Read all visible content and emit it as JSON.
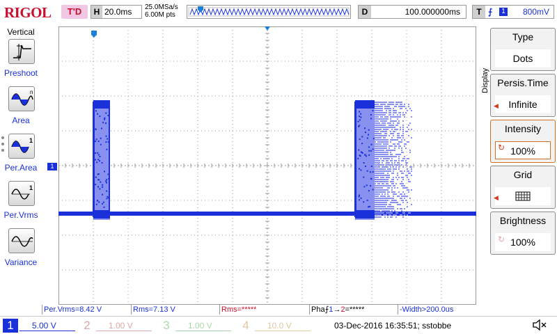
{
  "topbar": {
    "logo": "RIGOL",
    "trigger_status": "T'D",
    "horizontal": {
      "label": "H",
      "value": "20.0ms"
    },
    "sample_rate": "25.0MSa/s",
    "memory_depth": "6.00M pts",
    "delay": {
      "label": "D",
      "value": "100.000000ms"
    },
    "trigger": {
      "label": "T",
      "edge_symbol": "⨍",
      "channel": "1",
      "level": "800mV"
    }
  },
  "left_panel": {
    "title": "Vertical",
    "items": [
      {
        "label": "Preshoot",
        "icon": "preshoot-icon"
      },
      {
        "label": "Area",
        "icon": "area-icon"
      },
      {
        "label": "Per.Area",
        "icon": "per-area-icon"
      },
      {
        "label": "Per.Vrms",
        "icon": "per-vrms-icon"
      },
      {
        "label": "Variance",
        "icon": "variance-icon"
      }
    ]
  },
  "right_panel": {
    "menu_title": "Display",
    "buttons": [
      {
        "label": "Type",
        "value": "Dots"
      },
      {
        "label": "Persis.Time",
        "value": "Infinite"
      },
      {
        "label": "Intensity",
        "value": "100%"
      },
      {
        "label": "Grid",
        "value": ""
      },
      {
        "label": "Brightness",
        "value": "100%"
      }
    ]
  },
  "measurements": [
    {
      "text": "Per.Vrms=8.42 V"
    },
    {
      "text": "Rms=7.13 V"
    },
    {
      "text": "Rms=*****"
    },
    {
      "prefix": "Pha",
      "edge": "⨍",
      "a": "1",
      "arrow": "→",
      "b": "2",
      "suffix": "=*****"
    },
    {
      "text": "-Width>200.0us"
    }
  ],
  "channels": [
    {
      "number": "1",
      "scale": "5.00 V"
    },
    {
      "number": "2",
      "scale": "1.00 V"
    },
    {
      "number": "3",
      "scale": "1.00 V"
    },
    {
      "number": "4",
      "scale": "10.0 V"
    }
  ],
  "status_line": "03-Dec-2016 16:35:51; sstobbe",
  "colors": {
    "ch1": "#1a30d8",
    "ch1_persist": "#8890f0",
    "ch2": "#c8102e",
    "ch3": "#2ca02c",
    "ch4": "#d08a1e",
    "grid": "#9a9a9a",
    "accent": "#d26e1e"
  },
  "icons": {
    "speaker": "speaker-muted-icon",
    "trigger_marker": "trigger-marker-icon",
    "ch1_ground": "ch1-ground-marker-icon",
    "trigger_level": "trigger-level-marker-icon"
  }
}
